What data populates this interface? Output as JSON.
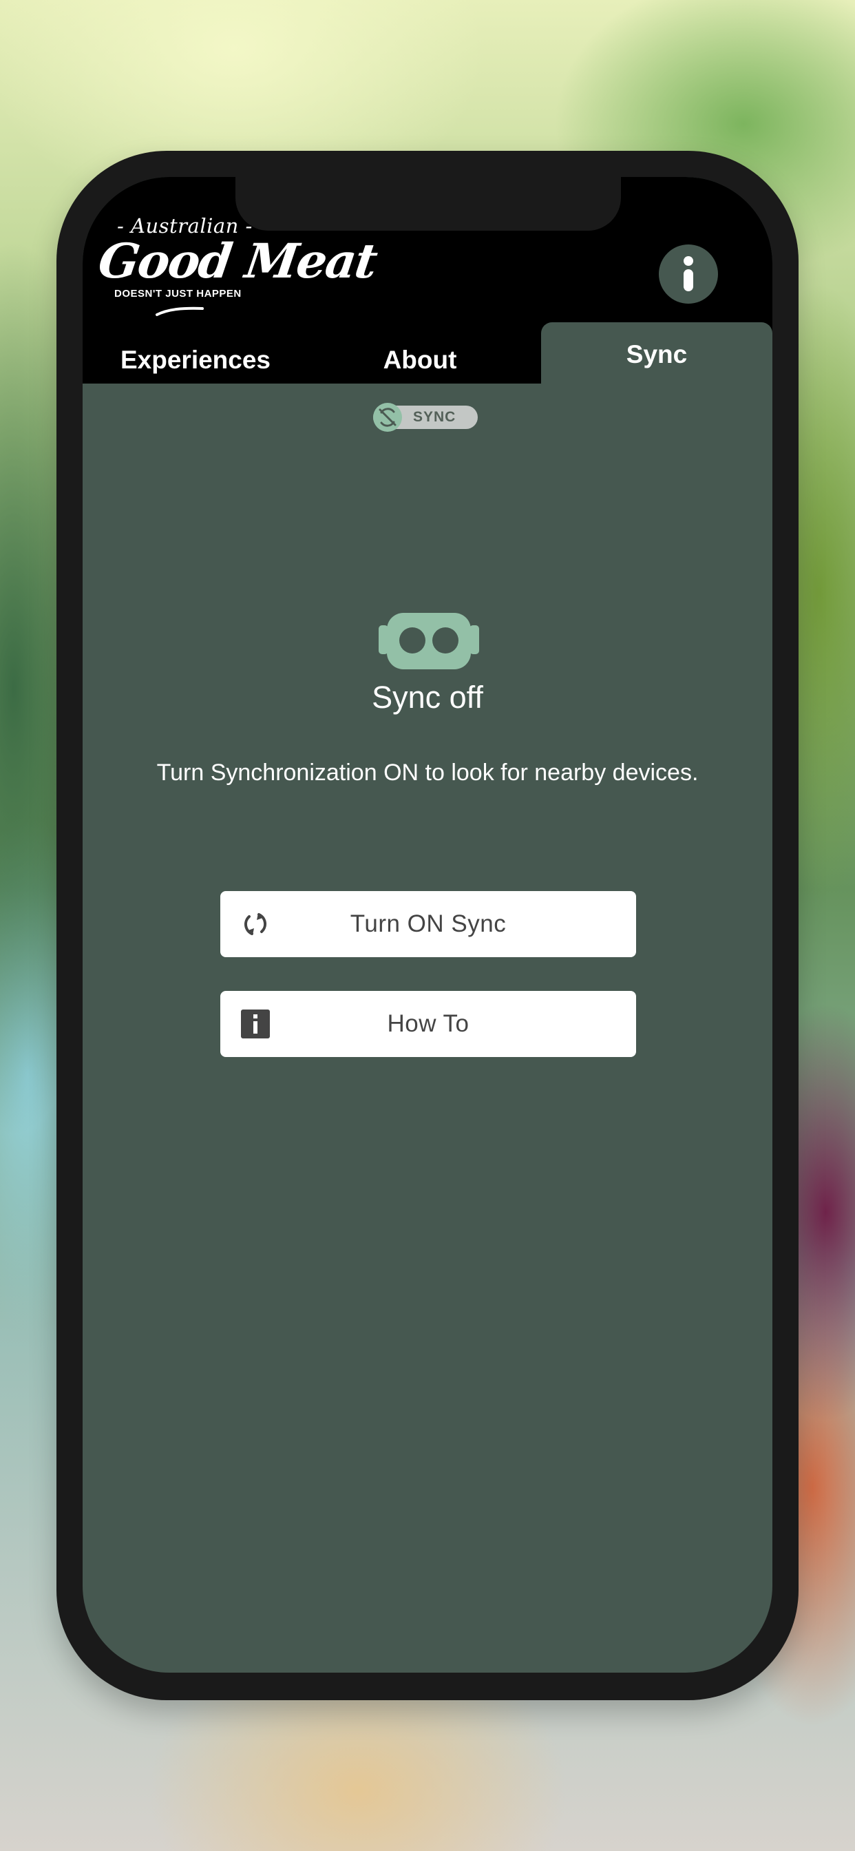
{
  "brand": {
    "top": "- Australian -",
    "main": "Good Meat",
    "sub": "DOESN'T JUST HAPPEN"
  },
  "tabs": [
    {
      "label": "Experiences"
    },
    {
      "label": "About"
    },
    {
      "label": "Sync",
      "selected": true
    }
  ],
  "sync_toggle": {
    "label": "SYNC",
    "state": "off"
  },
  "status": {
    "title": "Sync off",
    "description": "Turn Synchronization ON to look for nearby devices."
  },
  "buttons": {
    "turn_on": {
      "label": "Turn ON Sync",
      "icon": "refresh-icon"
    },
    "how_to": {
      "label": "How To",
      "icon": "info-icon"
    }
  },
  "icons": {
    "header_info": "info-icon",
    "sync_toggle": "sync-off-icon",
    "vr_headset": "vr-headset-icon"
  },
  "colors": {
    "panel": "#465850",
    "accent": "#93c0a7",
    "header": "#000000",
    "button_text": "#444444"
  }
}
